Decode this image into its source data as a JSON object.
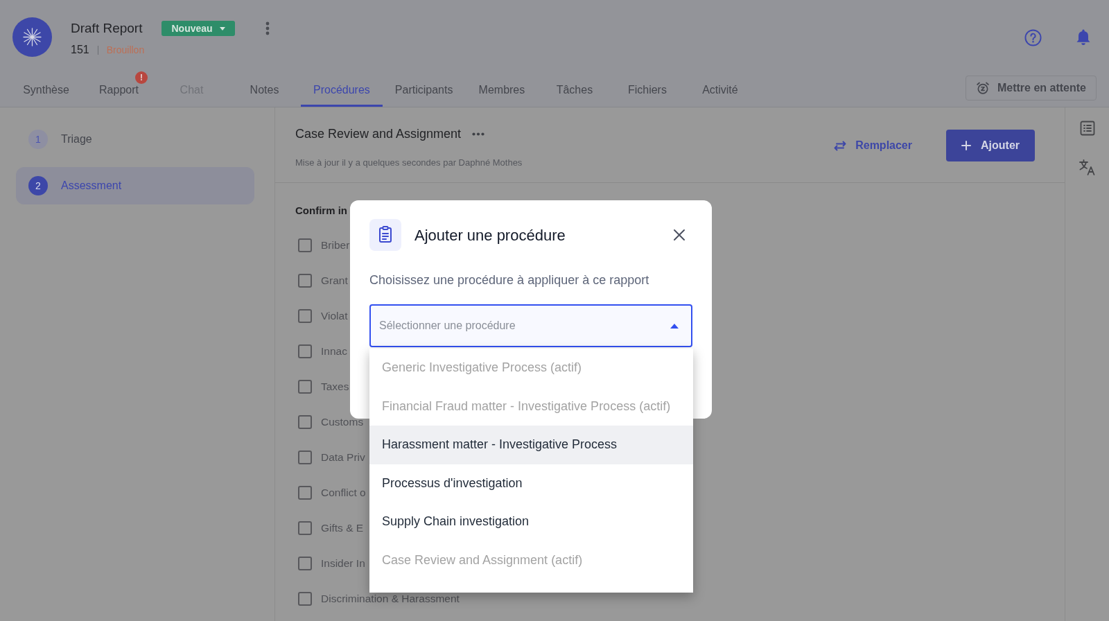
{
  "header": {
    "title": "Draft Report",
    "status": "Nouveau",
    "report_number": "151",
    "report_state": "Brouillon"
  },
  "tabs": [
    {
      "label": "Synthèse",
      "selected": false,
      "disabled": false
    },
    {
      "label": "Rapport",
      "selected": false,
      "disabled": false,
      "badge": "!"
    },
    {
      "label": "Chat",
      "selected": false,
      "disabled": true
    },
    {
      "label": "Notes",
      "selected": false,
      "disabled": false
    },
    {
      "label": "Procédures",
      "selected": true,
      "disabled": false
    },
    {
      "label": "Participants",
      "selected": false,
      "disabled": false
    },
    {
      "label": "Membres",
      "selected": false,
      "disabled": false
    },
    {
      "label": "Tâches",
      "selected": false,
      "disabled": false
    },
    {
      "label": "Fichiers",
      "selected": false,
      "disabled": false
    },
    {
      "label": "Activité",
      "selected": false,
      "disabled": false
    }
  ],
  "hold_button": {
    "label": "Mettre en attente"
  },
  "steps": [
    {
      "number": "1",
      "label": "Triage",
      "selected": false
    },
    {
      "number": "2",
      "label": "Assessment",
      "selected": true
    }
  ],
  "procedure": {
    "title": "Case Review and Assignment",
    "updated": "Mise à jour il y a quelques secondes par Daphné Mothes",
    "replace_button": "Remplacer",
    "add_button": "Ajouter"
  },
  "checklist": {
    "heading": "Confirm in",
    "items": [
      {
        "label": "Briber",
        "checked": false
      },
      {
        "label": "Grant",
        "checked": false
      },
      {
        "label": "Violat",
        "checked": false
      },
      {
        "label": "Innac",
        "checked": false
      },
      {
        "label": "Taxes",
        "checked": false
      },
      {
        "label": "Customs",
        "checked": false
      },
      {
        "label": "Data Priv",
        "checked": false
      },
      {
        "label": "Conflict o",
        "checked": false
      },
      {
        "label": "Gifts & E",
        "checked": false
      },
      {
        "label": "Insider In",
        "checked": false
      },
      {
        "label": "Discrimination & Harassment",
        "checked": false
      }
    ]
  },
  "modal": {
    "title": "Ajouter une procédure",
    "prompt": "Choisissez une procédure à appliquer à ce rapport",
    "select": {
      "placeholder": "Sélectionner une procédure",
      "expanded": true,
      "options": [
        {
          "label": "Generic Investigative Process (actif)",
          "disabled": true,
          "highlighted": false
        },
        {
          "label": "Financial Fraud matter - Investigative Process (actif)",
          "disabled": true,
          "highlighted": false
        },
        {
          "label": "Harassment matter - Investigative Process",
          "disabled": false,
          "highlighted": true
        },
        {
          "label": "Processus d'investigation",
          "disabled": false,
          "highlighted": false
        },
        {
          "label": "Supply Chain investigation",
          "disabled": false,
          "highlighted": false
        },
        {
          "label": "Case Review and Assignment (actif)",
          "disabled": true,
          "highlighted": false
        }
      ]
    }
  }
}
